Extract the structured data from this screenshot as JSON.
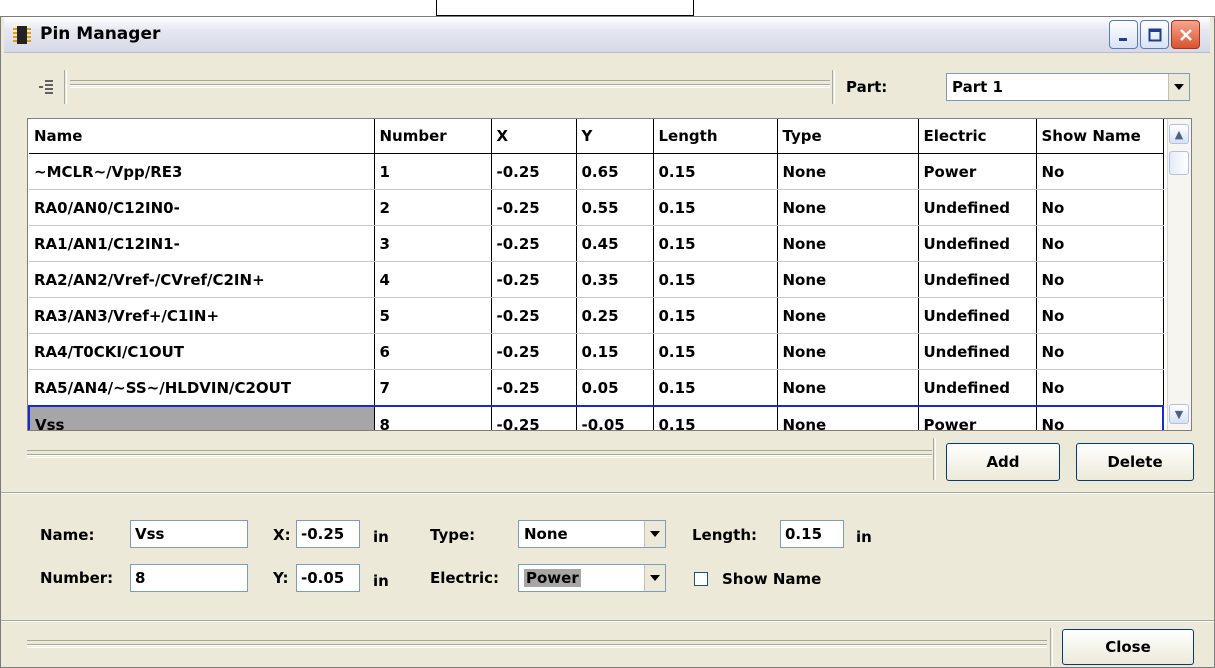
{
  "window": {
    "title": "Pin Manager"
  },
  "toolbar": {
    "part_label": "Part:",
    "part_value": "Part 1"
  },
  "grid": {
    "columns": [
      "Name",
      "Number",
      "X",
      "Y",
      "Length",
      "Type",
      "Electric",
      "Show Name"
    ],
    "rows": [
      [
        "~MCLR~/Vpp/RE3",
        "1",
        "-0.25",
        "0.65",
        "0.15",
        "None",
        "Power",
        "No"
      ],
      [
        "RA0/AN0/C12IN0-",
        "2",
        "-0.25",
        "0.55",
        "0.15",
        "None",
        "Undefined",
        "No"
      ],
      [
        "RA1/AN1/C12IN1-",
        "3",
        "-0.25",
        "0.45",
        "0.15",
        "None",
        "Undefined",
        "No"
      ],
      [
        "RA2/AN2/Vref-/CVref/C2IN+",
        "4",
        "-0.25",
        "0.35",
        "0.15",
        "None",
        "Undefined",
        "No"
      ],
      [
        "RA3/AN3/Vref+/C1IN+",
        "5",
        "-0.25",
        "0.25",
        "0.15",
        "None",
        "Undefined",
        "No"
      ],
      [
        "RA4/T0CKI/C1OUT",
        "6",
        "-0.25",
        "0.15",
        "0.15",
        "None",
        "Undefined",
        "No"
      ],
      [
        "RA5/AN4/~SS~/HLDVIN/C2OUT",
        "7",
        "-0.25",
        "0.05",
        "0.15",
        "None",
        "Undefined",
        "No"
      ],
      [
        "Vss",
        "8",
        "-0.25",
        "-0.05",
        "0.15",
        "None",
        "Power",
        "No"
      ]
    ]
  },
  "actions": {
    "add": "Add",
    "delete": "Delete",
    "close": "Close"
  },
  "form": {
    "name_label": "Name:",
    "name_value": "Vss",
    "number_label": "Number:",
    "number_value": "8",
    "x_label": "X:",
    "x_value": "-0.25",
    "x_unit": "in",
    "y_label": "Y:",
    "y_value": "-0.05",
    "y_unit": "in",
    "type_label": "Type:",
    "type_value": "None",
    "electric_label": "Electric:",
    "electric_value": "Power",
    "length_label": "Length:",
    "length_value": "0.15",
    "length_unit": "in",
    "show_name_label": "Show Name",
    "show_name_checked": false
  },
  "icons": {
    "app": "chip-icon",
    "pins": "pin-list-icon",
    "minimize": "minimize-icon",
    "maximize": "maximize-icon",
    "close": "close-icon",
    "dropdown": "chevron-down-icon",
    "scroll_up": "chevron-up-icon",
    "scroll_down": "chevron-down-icon"
  }
}
